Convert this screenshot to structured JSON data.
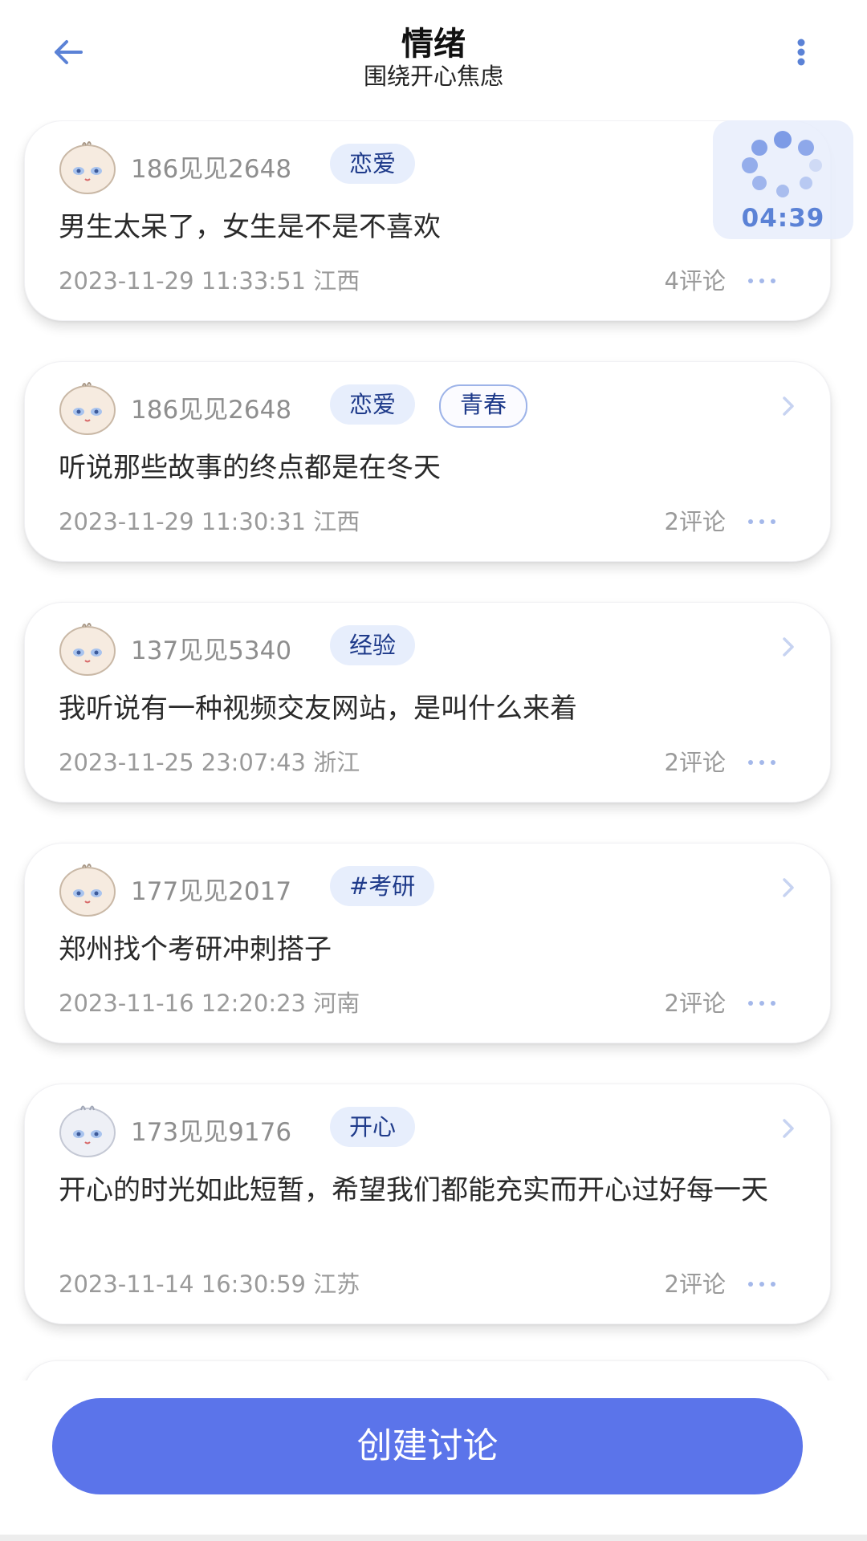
{
  "header": {
    "title": "情绪",
    "subtitle": "围绕开心焦虑",
    "back_icon": "arrow-left-icon",
    "more_icon": "more-vertical-icon",
    "accent_color": "#5b82d6"
  },
  "loader": {
    "time": "04:39"
  },
  "posts": [
    {
      "user": "186见见2648",
      "tags": [
        "恋爱"
      ],
      "content": "男生太呆了，女生是不是不喜欢",
      "meta": "2023-11-29 11:33:51 江西",
      "comments": "4评论"
    },
    {
      "user": "186见见2648",
      "tags": [
        "恋爱",
        "青春"
      ],
      "content": "听说那些故事的终点都是在冬天",
      "meta": "2023-11-29 11:30:31 江西",
      "comments": "2评论"
    },
    {
      "user": "137见见5340",
      "tags": [
        "经验"
      ],
      "content": "我听说有一种视频交友网站，是叫什么来着",
      "meta": "2023-11-25 23:07:43 浙江",
      "comments": "2评论"
    },
    {
      "user": "177见见2017",
      "tags": [
        "#考研"
      ],
      "content": "郑州找个考研冲刺搭子",
      "meta": "2023-11-16 12:20:23 河南",
      "comments": "2评论"
    },
    {
      "user": "173见见9176",
      "tags": [
        "开心"
      ],
      "content": "开心的时光如此短暂，希望我们都能充实而开心过好每一天",
      "meta": "2023-11-14 16:30:59 江苏",
      "comments": "2评论"
    }
  ],
  "create_button": {
    "label": "创建讨论",
    "color": "#5b74ea"
  }
}
